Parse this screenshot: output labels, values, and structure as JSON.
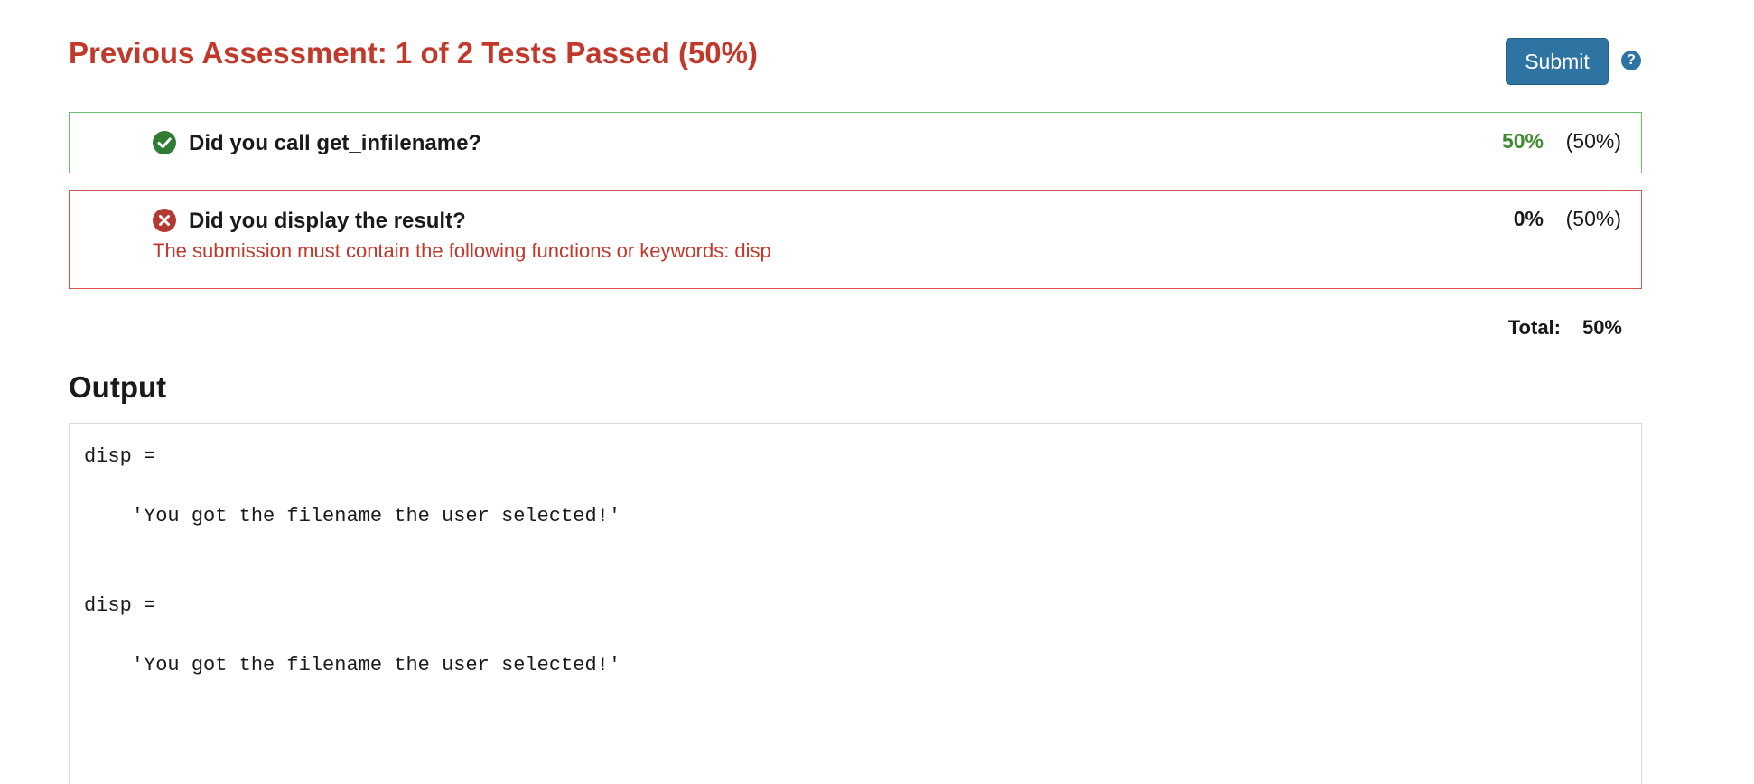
{
  "assessment": {
    "title": "Previous Assessment: 1 of 2 Tests Passed (50%)",
    "submit_label": "Submit",
    "help_glyph": "?"
  },
  "tests": [
    {
      "status": "pass",
      "icon": "check-circle-icon",
      "question": "Did you call get_infilename?",
      "message": "",
      "score": "50%",
      "weight": "(50%)"
    },
    {
      "status": "fail",
      "icon": "x-circle-icon",
      "question": "Did you display the result?",
      "message": "The submission must contain the following functions or keywords: disp",
      "score": "0%",
      "weight": "(50%)"
    }
  ],
  "total": {
    "label": "Total:",
    "value": "50%"
  },
  "output": {
    "heading": "Output",
    "text": "disp =\n\n    'You got the filename the user selected!'\n\n\ndisp =\n\n    'You got the filename the user selected!'"
  },
  "colors": {
    "fail_red": "#c0392b",
    "pass_green": "#3c8a2e",
    "submit_blue": "#2e74a3",
    "pass_border": "#6bbf6b",
    "fail_border": "#d9534f"
  }
}
